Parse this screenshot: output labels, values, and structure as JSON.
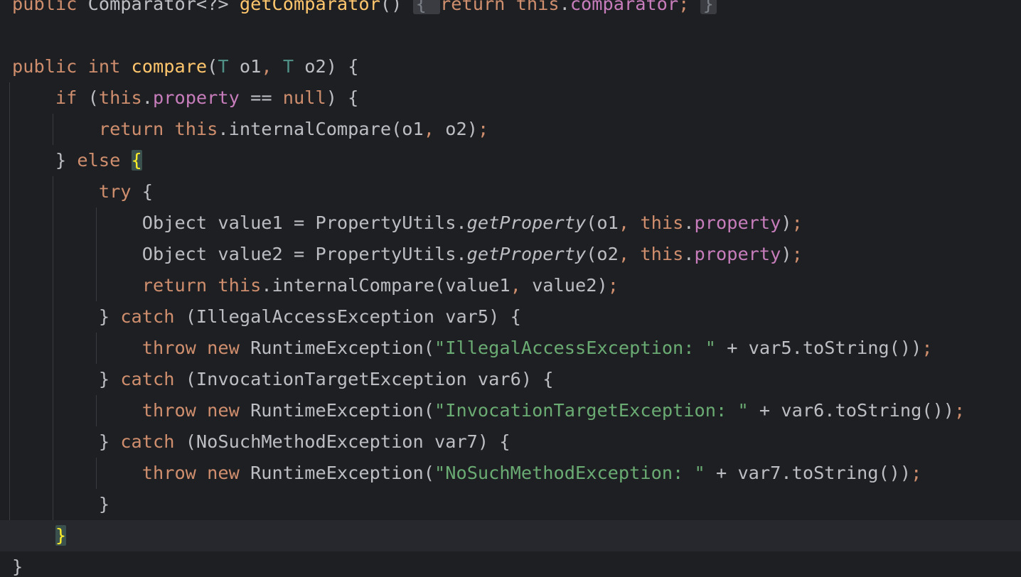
{
  "lines": [
    {
      "indent": 0,
      "current": false,
      "tokens": [
        {
          "t": "public ",
          "c": "kw"
        },
        {
          "t": "Comparator<?> ",
          "c": ""
        },
        {
          "t": "getComparator",
          "c": "fnd"
        },
        {
          "t": "() ",
          "c": ""
        },
        {
          "t": "{ ",
          "c": "fold"
        },
        {
          "t": "return ",
          "c": "kw dim-kw"
        },
        {
          "t": "this",
          "c": "kw"
        },
        {
          "t": ".",
          "c": ""
        },
        {
          "t": "comparator",
          "c": "fld"
        },
        {
          "t": "; ",
          "c": "kw"
        },
        {
          "t": "}",
          "c": "fold"
        }
      ]
    },
    {
      "indent": 0,
      "current": false,
      "tokens": []
    },
    {
      "indent": 0,
      "current": false,
      "tokens": [
        {
          "t": "public ",
          "c": "kw"
        },
        {
          "t": "int ",
          "c": "kw"
        },
        {
          "t": "compare",
          "c": "fnd"
        },
        {
          "t": "(",
          "c": ""
        },
        {
          "t": "T",
          "c": "tpv"
        },
        {
          "t": " o1",
          "c": ""
        },
        {
          "t": ", ",
          "c": "kw"
        },
        {
          "t": "T",
          "c": "tpv"
        },
        {
          "t": " o2) {",
          "c": ""
        }
      ]
    },
    {
      "indent": 1,
      "current": false,
      "tokens": [
        {
          "t": "if ",
          "c": "kw"
        },
        {
          "t": "(",
          "c": ""
        },
        {
          "t": "this",
          "c": "kw"
        },
        {
          "t": ".",
          "c": ""
        },
        {
          "t": "property",
          "c": "fld"
        },
        {
          "t": " == ",
          "c": ""
        },
        {
          "t": "null",
          "c": "kw"
        },
        {
          "t": ") {",
          "c": ""
        }
      ]
    },
    {
      "indent": 2,
      "current": false,
      "tokens": [
        {
          "t": "return ",
          "c": "kw"
        },
        {
          "t": "this",
          "c": "kw"
        },
        {
          "t": ".internalCompare(o1",
          "c": ""
        },
        {
          "t": ", ",
          "c": "kw"
        },
        {
          "t": "o2)",
          "c": ""
        },
        {
          "t": ";",
          "c": "kw"
        }
      ]
    },
    {
      "indent": 1,
      "current": false,
      "tokens": [
        {
          "t": "} ",
          "c": ""
        },
        {
          "t": "else ",
          "c": "kw"
        },
        {
          "t": "{",
          "c": "hl"
        }
      ]
    },
    {
      "indent": 2,
      "current": false,
      "tokens": [
        {
          "t": "try ",
          "c": "kw"
        },
        {
          "t": "{",
          "c": ""
        }
      ]
    },
    {
      "indent": 3,
      "current": false,
      "tokens": [
        {
          "t": "Object value1 = PropertyUtils.",
          "c": ""
        },
        {
          "t": "getProperty",
          "c": "it"
        },
        {
          "t": "(o1",
          "c": ""
        },
        {
          "t": ", ",
          "c": "kw"
        },
        {
          "t": "this",
          "c": "kw"
        },
        {
          "t": ".",
          "c": ""
        },
        {
          "t": "property",
          "c": "fld"
        },
        {
          "t": ")",
          "c": ""
        },
        {
          "t": ";",
          "c": "kw"
        }
      ]
    },
    {
      "indent": 3,
      "current": false,
      "tokens": [
        {
          "t": "Object value2 = PropertyUtils.",
          "c": ""
        },
        {
          "t": "getProperty",
          "c": "it"
        },
        {
          "t": "(o2",
          "c": ""
        },
        {
          "t": ", ",
          "c": "kw"
        },
        {
          "t": "this",
          "c": "kw"
        },
        {
          "t": ".",
          "c": ""
        },
        {
          "t": "property",
          "c": "fld"
        },
        {
          "t": ")",
          "c": ""
        },
        {
          "t": ";",
          "c": "kw"
        }
      ]
    },
    {
      "indent": 3,
      "current": false,
      "tokens": [
        {
          "t": "return ",
          "c": "kw"
        },
        {
          "t": "this",
          "c": "kw"
        },
        {
          "t": ".internalCompare(value1",
          "c": ""
        },
        {
          "t": ", ",
          "c": "kw"
        },
        {
          "t": "value2)",
          "c": ""
        },
        {
          "t": ";",
          "c": "kw"
        }
      ]
    },
    {
      "indent": 2,
      "current": false,
      "tokens": [
        {
          "t": "} ",
          "c": ""
        },
        {
          "t": "catch ",
          "c": "kw"
        },
        {
          "t": "(IllegalAccessException var5) {",
          "c": ""
        }
      ]
    },
    {
      "indent": 3,
      "current": false,
      "tokens": [
        {
          "t": "throw ",
          "c": "kw"
        },
        {
          "t": "new ",
          "c": "kw"
        },
        {
          "t": "RuntimeException(",
          "c": ""
        },
        {
          "t": "\"IllegalAccessException: \"",
          "c": "str"
        },
        {
          "t": " + var5.toString())",
          "c": ""
        },
        {
          "t": ";",
          "c": "kw"
        }
      ]
    },
    {
      "indent": 2,
      "current": false,
      "tokens": [
        {
          "t": "} ",
          "c": ""
        },
        {
          "t": "catch ",
          "c": "kw"
        },
        {
          "t": "(InvocationTargetException var6) {",
          "c": ""
        }
      ]
    },
    {
      "indent": 3,
      "current": false,
      "tokens": [
        {
          "t": "throw ",
          "c": "kw"
        },
        {
          "t": "new ",
          "c": "kw"
        },
        {
          "t": "RuntimeException(",
          "c": ""
        },
        {
          "t": "\"InvocationTargetException: \"",
          "c": "str"
        },
        {
          "t": " + var6.toString())",
          "c": ""
        },
        {
          "t": ";",
          "c": "kw"
        }
      ]
    },
    {
      "indent": 2,
      "current": false,
      "tokens": [
        {
          "t": "} ",
          "c": ""
        },
        {
          "t": "catch ",
          "c": "kw"
        },
        {
          "t": "(NoSuchMethodException var7) {",
          "c": ""
        }
      ]
    },
    {
      "indent": 3,
      "current": false,
      "tokens": [
        {
          "t": "throw ",
          "c": "kw"
        },
        {
          "t": "new ",
          "c": "kw"
        },
        {
          "t": "RuntimeException(",
          "c": ""
        },
        {
          "t": "\"NoSuchMethodException: \"",
          "c": "str"
        },
        {
          "t": " + var7.toString())",
          "c": ""
        },
        {
          "t": ";",
          "c": "kw"
        }
      ]
    },
    {
      "indent": 2,
      "current": false,
      "tokens": [
        {
          "t": "}",
          "c": ""
        }
      ]
    },
    {
      "indent": 1,
      "current": true,
      "tokens": [
        {
          "t": "}",
          "c": "hl"
        }
      ]
    },
    {
      "indent": 0,
      "current": false,
      "tokens": [
        {
          "t": "}",
          "c": ""
        }
      ]
    }
  ],
  "theme": {
    "background": "#1e1f22",
    "current_line": "#26282e",
    "keyword": "#cf8e6d",
    "method_decl": "#ffc66d",
    "field": "#c77dbb",
    "string": "#6aab73",
    "type_param": "#4f8f85",
    "default": "#bcbec4",
    "brace_match_bg": "#3b514d",
    "brace_match_fg": "#ffef28"
  }
}
